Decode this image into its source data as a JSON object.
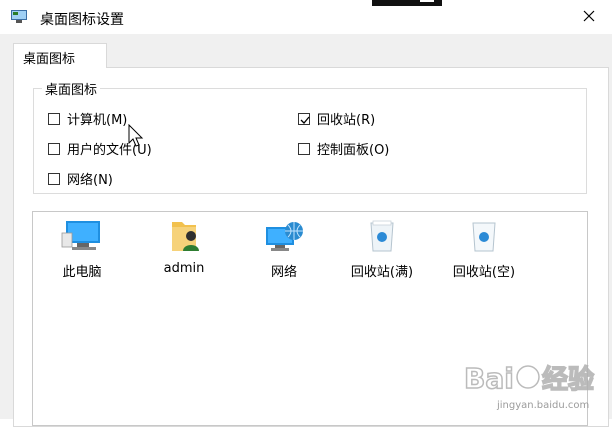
{
  "window": {
    "title": "桌面图标设置"
  },
  "tabs": [
    {
      "label": "桌面图标",
      "selected": true
    }
  ],
  "group": {
    "title": "桌面图标",
    "checkboxes": [
      {
        "label": "计算机(M)",
        "checked": false
      },
      {
        "label": "回收站(R)",
        "checked": true
      },
      {
        "label": "用户的文件(U)",
        "checked": false
      },
      {
        "label": "控制面板(O)",
        "checked": false
      },
      {
        "label": "网络(N)",
        "checked": false
      }
    ]
  },
  "icons": [
    {
      "label": "此电脑",
      "icon": "computer-icon"
    },
    {
      "label": "admin",
      "icon": "user-folder-icon"
    },
    {
      "label": "网络",
      "icon": "network-icon"
    },
    {
      "label": "回收站(满)",
      "icon": "recycle-bin-full-icon"
    },
    {
      "label": "回收站(空)",
      "icon": "recycle-bin-empty-icon"
    }
  ],
  "watermark": {
    "brand": "Bai 经验",
    "url": "jingyan.baidu.com"
  },
  "colors": {
    "window_bg": "#f0f0f0",
    "panel_bg": "#ffffff",
    "border": "#d9d9d9",
    "icon_blue": "#1e88d8"
  }
}
